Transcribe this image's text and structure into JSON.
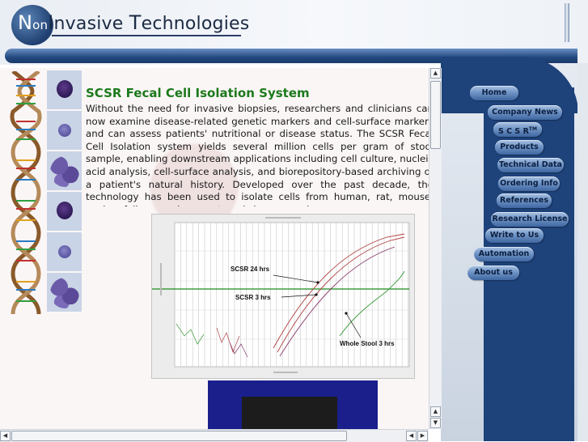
{
  "header": {
    "logo": {
      "part1_cap": "N",
      "part1_rest": "on",
      "part2_cap": "I",
      "part2_rest": "nvasive ",
      "part3_cap": "T",
      "part3_rest": "echnologies"
    }
  },
  "article": {
    "title": "SCSR Fecal Cell Isolation System",
    "body": "Without the need for invasive biopsies, researchers and clinicians can now examine disease-related genetic markers and cell-surface markers and can assess patients' nutritional or disease status. The SCSR Fecal Cell Isolation system yields several million cells per gram of stool sample, enabling downstream applications including cell culture, nucleic acid analysis, cell-surface analysis, and biorepository-based archiving of a patient's natural history. Developed over the past decade, the technology has been used to isolate cells from human, rat, mouse, canine, feline, monkey, goat, and sheep samples."
  },
  "figure": {
    "labels": [
      "SCSR 24 hrs",
      "SCSR 3 hrs",
      "Whole Stool 3 hrs"
    ],
    "series_colors": {
      "threshold": "#1a8a1a",
      "scsr24": "#b04040",
      "scsr3": "#8a3a6a",
      "stool": "#3a9a3a"
    }
  },
  "nav": {
    "items": [
      {
        "label": "Home"
      },
      {
        "label": "Company News"
      },
      {
        "label": "S C S R",
        "sup": "TM"
      },
      {
        "label": "Products"
      },
      {
        "label": "Technical Data"
      },
      {
        "label": "Ordering Info"
      },
      {
        "label": "References"
      },
      {
        "label": "Research License"
      },
      {
        "label": "Write to Us"
      },
      {
        "label": "Automation"
      },
      {
        "label": "About us"
      }
    ]
  },
  "icons": {
    "scroll_up": "up-arrow-icon",
    "scroll_down": "down-arrow-icon",
    "scroll_left": "left-arrow-icon",
    "scroll_right": "right-arrow-icon"
  },
  "colors": {
    "accent_navy": "#1e427a",
    "title_green": "#1c7a1c",
    "nav_button": "#7095c6"
  }
}
